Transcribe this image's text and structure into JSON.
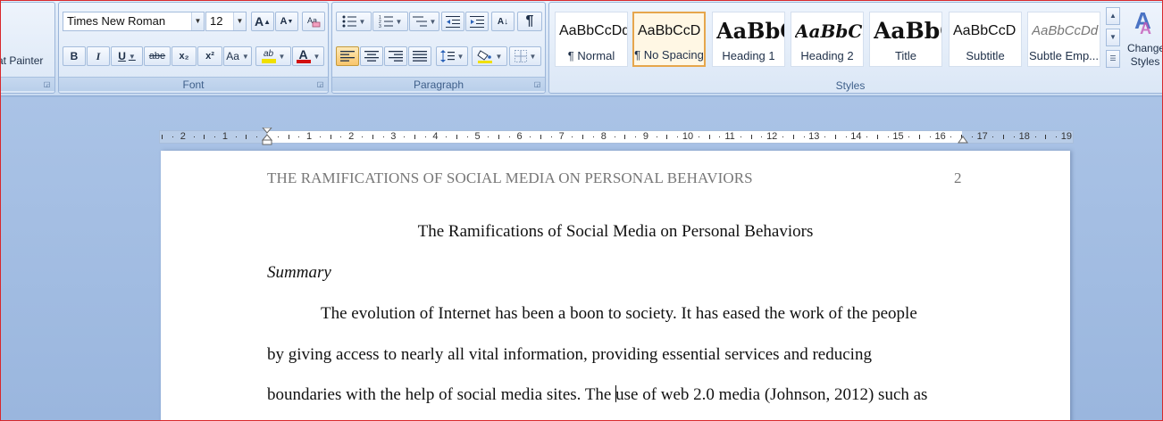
{
  "clipboard": {
    "format_painter": "at Painter"
  },
  "font": {
    "group_label": "Font",
    "family": "Times New Roman",
    "size": "12",
    "grow_icon": "A",
    "shrink_icon": "A",
    "bold": "B",
    "italic": "I",
    "underline": "U",
    "strikethrough": "abe",
    "subscript": "x₂",
    "superscript": "x²",
    "change_case": "Aa",
    "highlight": "ab",
    "font_color": "A",
    "highlight_color": "#f0e000",
    "font_color_value": "#d21010"
  },
  "paragraph": {
    "group_label": "Paragraph",
    "sort": "A↓",
    "show_marks": "¶"
  },
  "styles": {
    "group_label": "Styles",
    "change_styles_line1": "Change",
    "change_styles_line2": "Styles",
    "items": [
      {
        "sample": "AaBbCcDd",
        "name": "¶ Normal"
      },
      {
        "sample": "AaBbCcD",
        "name": "¶ No Spacing"
      },
      {
        "sample": "AaBbC",
        "name": "Heading 1"
      },
      {
        "sample": "AaBbCc",
        "name": "Heading 2"
      },
      {
        "sample": "AaBbC",
        "name": "Title"
      },
      {
        "sample": "AaBbCcD",
        "name": "Subtitle"
      },
      {
        "sample": "AaBbCcDd",
        "name": "Subtle Emp..."
      }
    ]
  },
  "ruler": {
    "labels": [
      "2",
      "1",
      "1",
      "2",
      "3",
      "4",
      "5",
      "6",
      "7",
      "8",
      "9",
      "10",
      "11",
      "12",
      "13",
      "14",
      "15",
      "16",
      "17",
      "18",
      "19"
    ]
  },
  "document": {
    "running_head": "THE RAMIFICATIONS OF SOCIAL MEDIA ON PERSONAL BEHAVIORS",
    "page_number": "2",
    "title": "The Ramifications of Social Media on Personal Behaviors",
    "summary_heading": "Summary",
    "line1": "The evolution of Internet has been a boon to society. It has eased the work of the people",
    "line2": "by giving access to nearly all vital information, providing essential services and reducing",
    "line3_before_cursor": "boundaries with the help of social media sites. The ",
    "line3_after_cursor": "use of web 2.0 media (Johnson, 2012) such as"
  }
}
